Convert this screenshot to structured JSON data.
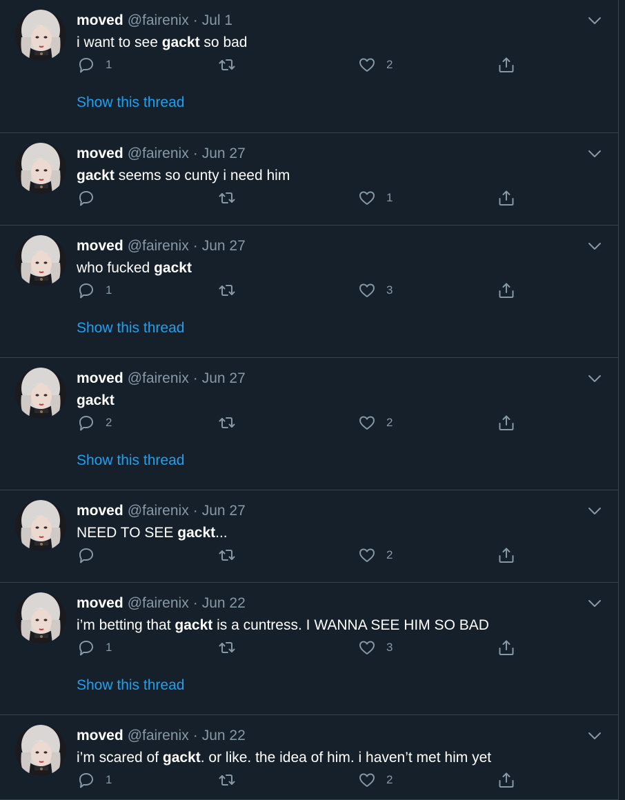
{
  "tweets": [
    {
      "name": "moved",
      "handle": "@fairenix",
      "sep": "·",
      "date": "Jul 1",
      "text_parts": [
        {
          "t": "i want to see ",
          "b": false
        },
        {
          "t": "gackt",
          "b": true
        },
        {
          "t": " so bad",
          "b": false
        }
      ],
      "replies": "1",
      "retweets": "",
      "likes": "2",
      "show_thread": "Show this thread"
    },
    {
      "name": "moved",
      "handle": "@fairenix",
      "sep": "·",
      "date": "Jun 27",
      "text_parts": [
        {
          "t": "gackt",
          "b": true
        },
        {
          "t": " seems so cunty i need him",
          "b": false
        }
      ],
      "replies": "",
      "retweets": "",
      "likes": "1",
      "show_thread": ""
    },
    {
      "name": "moved",
      "handle": "@fairenix",
      "sep": "·",
      "date": "Jun 27",
      "text_parts": [
        {
          "t": "who fucked ",
          "b": false
        },
        {
          "t": "gackt",
          "b": true
        }
      ],
      "replies": "1",
      "retweets": "",
      "likes": "3",
      "show_thread": "Show this thread"
    },
    {
      "name": "moved",
      "handle": "@fairenix",
      "sep": "·",
      "date": "Jun 27",
      "text_parts": [
        {
          "t": "gackt",
          "b": true
        }
      ],
      "replies": "2",
      "retweets": "",
      "likes": "2",
      "show_thread": "Show this thread"
    },
    {
      "name": "moved",
      "handle": "@fairenix",
      "sep": "·",
      "date": "Jun 27",
      "text_parts": [
        {
          "t": "NEED TO SEE ",
          "b": false
        },
        {
          "t": "gackt",
          "b": true
        },
        {
          "t": "...",
          "b": false
        }
      ],
      "replies": "",
      "retweets": "",
      "likes": "2",
      "show_thread": ""
    },
    {
      "name": "moved",
      "handle": "@fairenix",
      "sep": "·",
      "date": "Jun 22",
      "text_parts": [
        {
          "t": "i’m betting that ",
          "b": false
        },
        {
          "t": "gackt",
          "b": true
        },
        {
          "t": " is a cuntress. I WANNA SEE HIM SO BAD",
          "b": false
        }
      ],
      "replies": "1",
      "retweets": "",
      "likes": "3",
      "show_thread": "Show this thread"
    },
    {
      "name": "moved",
      "handle": "@fairenix",
      "sep": "·",
      "date": "Jun 22",
      "text_parts": [
        {
          "t": "i’m scared of ",
          "b": false
        },
        {
          "t": "gackt",
          "b": true
        },
        {
          "t": ". or like. the idea of him. i haven’t met him yet",
          "b": false
        }
      ],
      "replies": "1",
      "retweets": "",
      "likes": "2",
      "show_thread": ""
    }
  ],
  "colors": {
    "background": "#15202b",
    "border": "#38444d",
    "secondary_text": "#8899a6",
    "link": "#1da1f2"
  },
  "icons": [
    "reply-icon",
    "retweet-icon",
    "like-icon",
    "share-icon",
    "chevron-down-icon"
  ]
}
